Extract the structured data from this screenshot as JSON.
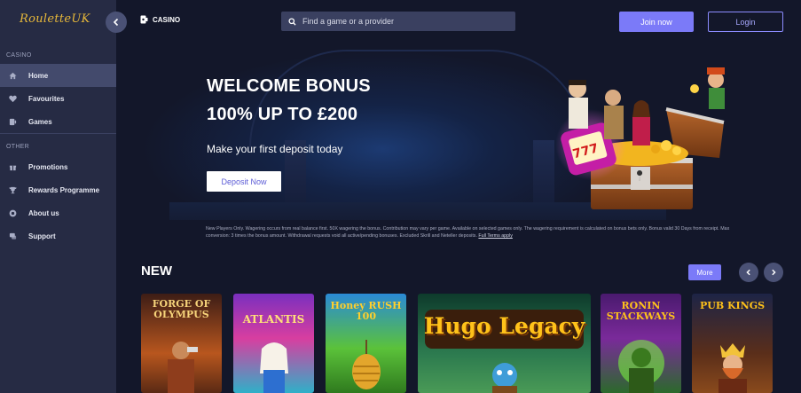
{
  "sidebar": {
    "logo": "RouletteUK",
    "section_casino": "CASINO",
    "section_other": "OTHER",
    "items": [
      {
        "label": "Home",
        "icon": "home-icon"
      },
      {
        "label": "Favourites",
        "icon": "heart-icon"
      },
      {
        "label": "Games",
        "icon": "games-icon"
      },
      {
        "label": "Promotions",
        "icon": "gift-icon"
      },
      {
        "label": "Rewards Programme",
        "icon": "trophy-icon"
      },
      {
        "label": "About us",
        "icon": "info-icon"
      },
      {
        "label": "Support",
        "icon": "support-icon"
      }
    ]
  },
  "header": {
    "casino_label": "CASINO",
    "search_placeholder": "Find a game or a provider",
    "join_label": "Join now",
    "login_label": "Login"
  },
  "hero": {
    "title_line1": "WELCOME BONUS",
    "title_line2": "100% UP TO £200",
    "subtitle": "Make your first deposit today",
    "cta_label": "Deposit Now",
    "terms": "New Players Only. Wagering occurs from real balance first. 50X wagering the bonus. Contribution may vary per game. Available on selected games only. The wagering requirement is calculated on bonus bets only. Bonus valid 30 Days from receipt. Max conversion: 3 times the bonus amount. Withdrawal requests void all active/pending bonuses. Excluded Skrill and Neteller deposits.",
    "terms_link": "Full Terms apply"
  },
  "new_section": {
    "title": "NEW",
    "more_label": "More",
    "games": [
      {
        "name": "FORGE OF OLYMPUS",
        "title_text": "FORGE OF OLYMPUS"
      },
      {
        "name": "Atlantis",
        "title_text": "ATLANTIS"
      },
      {
        "name": "Honey Rush 100",
        "title_text": "Honey RUSH 100"
      },
      {
        "name": "Hugo Legacy",
        "title_text": "Hugo Legacy"
      },
      {
        "name": "Ronin Stackways",
        "title_text": "RONIN STACKWAYS"
      },
      {
        "name": "Pub Kings",
        "title_text": "PUB KINGS"
      }
    ]
  },
  "colors": {
    "accent": "#7b7af8",
    "sidebar_bg": "#262b44",
    "page_bg": "#13172a",
    "logo_gold": "#e8b93a"
  }
}
